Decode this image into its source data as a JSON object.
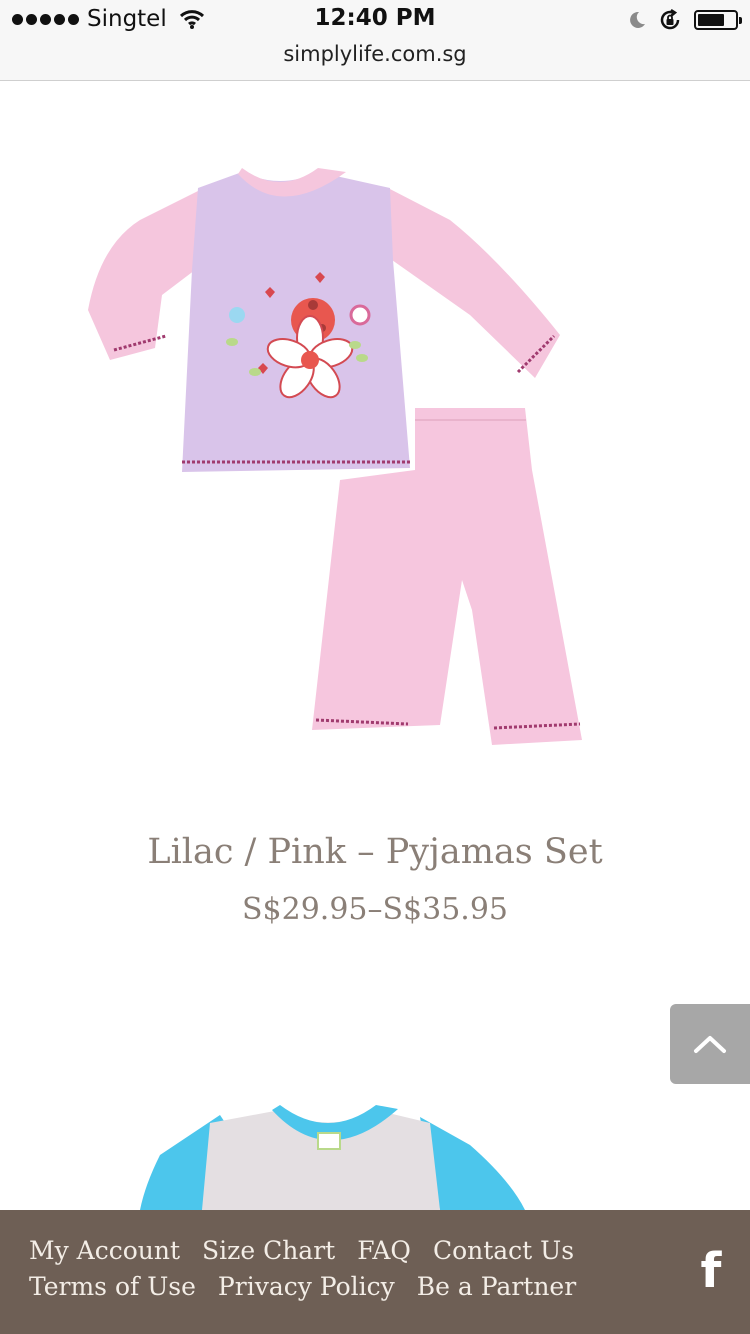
{
  "status_bar": {
    "carrier": "Singtel",
    "time": "12:40 PM",
    "url": "simplylife.com.sg",
    "battery_level": 0.75
  },
  "product": {
    "title": "Lilac / Pink – Pyjamas Set",
    "price": "S$29.95–S$35.95",
    "image_icon": "pyjamas-set-image",
    "colors": {
      "top": "#d9c4ea",
      "sleeves": "#f5c6dd",
      "pants": "#f6c6de",
      "trim": "#a03a6e"
    }
  },
  "next_product": {
    "image_icon": "pyjamas-set-image",
    "colors": {
      "body": "#e4dfe2",
      "sleeves": "#4cc6ec"
    }
  },
  "back_to_top": {
    "icon": "chevron-up-icon"
  },
  "footer": {
    "background": "#6e5f55",
    "row1": [
      "My Account",
      "Size Chart",
      "FAQ",
      "Contact Us"
    ],
    "row2": [
      "Terms of Use",
      "Privacy Policy",
      "Be a Partner"
    ],
    "social_icon": "facebook-icon",
    "social_glyph": "f"
  }
}
